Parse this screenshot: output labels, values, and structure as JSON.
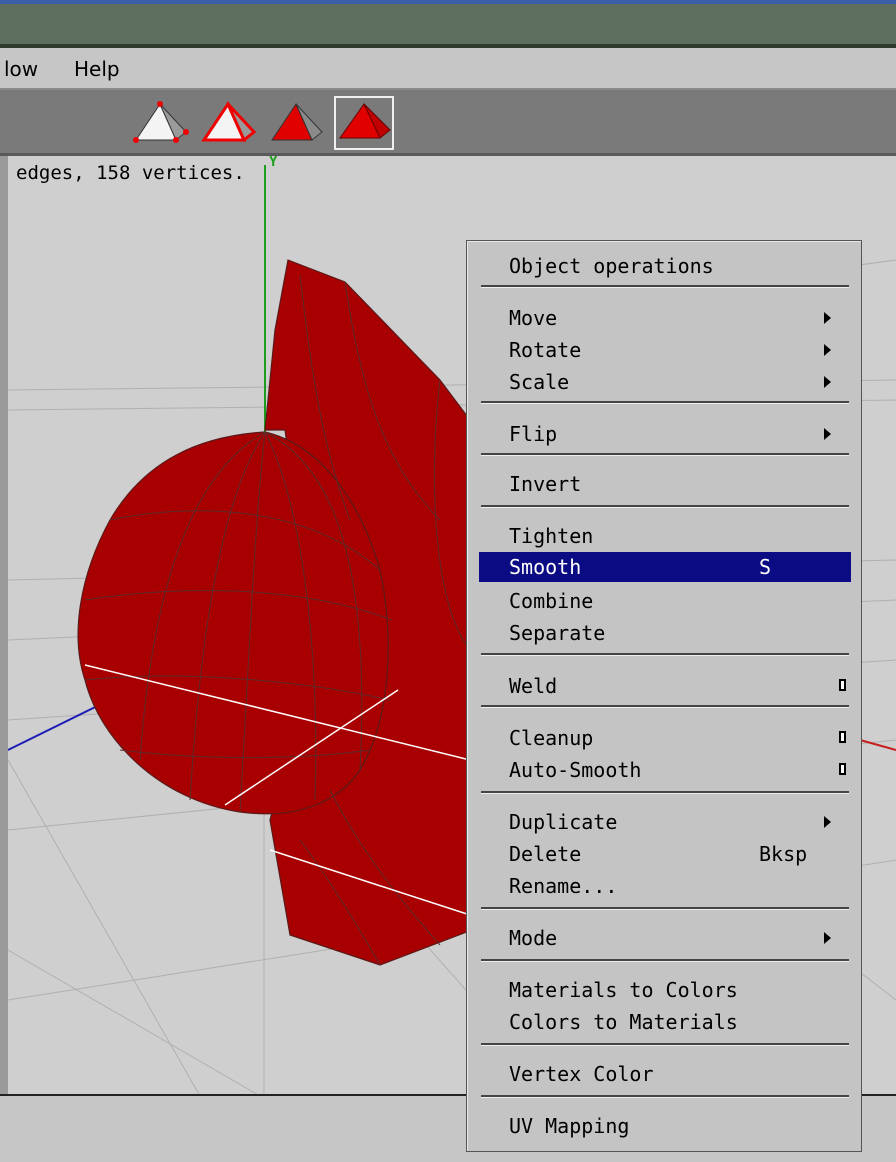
{
  "menubar": {
    "items": [
      "low",
      "Help"
    ]
  },
  "toolbar": {
    "buttons": [
      {
        "name": "vertex-select-mode-icon"
      },
      {
        "name": "edge-select-mode-icon"
      },
      {
        "name": "face-select-mode-icon"
      },
      {
        "name": "object-select-mode-icon",
        "selected": true
      }
    ]
  },
  "viewport": {
    "status": "edges, 158 vertices.",
    "axis_y_label": "Y"
  },
  "colors": {
    "model": "#a80000",
    "highlight": "#0b0b83",
    "y_axis": "#1e9e1e",
    "x_axis": "#c81e1e",
    "z_axis": "#1e1eb4"
  },
  "context_menu": {
    "title": "Object operations",
    "items": [
      {
        "label": "Move",
        "submenu": true
      },
      {
        "label": "Rotate",
        "submenu": true
      },
      {
        "label": "Scale",
        "submenu": true
      },
      {
        "label": "Flip",
        "submenu": true
      },
      {
        "label": "Invert"
      },
      {
        "label": "Tighten"
      },
      {
        "label": "Smooth",
        "shortcut": "S",
        "highlighted": true
      },
      {
        "label": "Combine"
      },
      {
        "label": "Separate"
      },
      {
        "label": "Weld",
        "option_box": true
      },
      {
        "label": "Cleanup",
        "option_box": true
      },
      {
        "label": "Auto-Smooth",
        "option_box": true
      },
      {
        "label": "Duplicate",
        "submenu": true
      },
      {
        "label": "Delete",
        "shortcut": "Bksp"
      },
      {
        "label": "Rename..."
      },
      {
        "label": "Mode",
        "submenu": true
      },
      {
        "label": "Materials to Colors"
      },
      {
        "label": "Colors to Materials"
      },
      {
        "label": "Vertex Color"
      },
      {
        "label": "UV Mapping"
      }
    ]
  }
}
